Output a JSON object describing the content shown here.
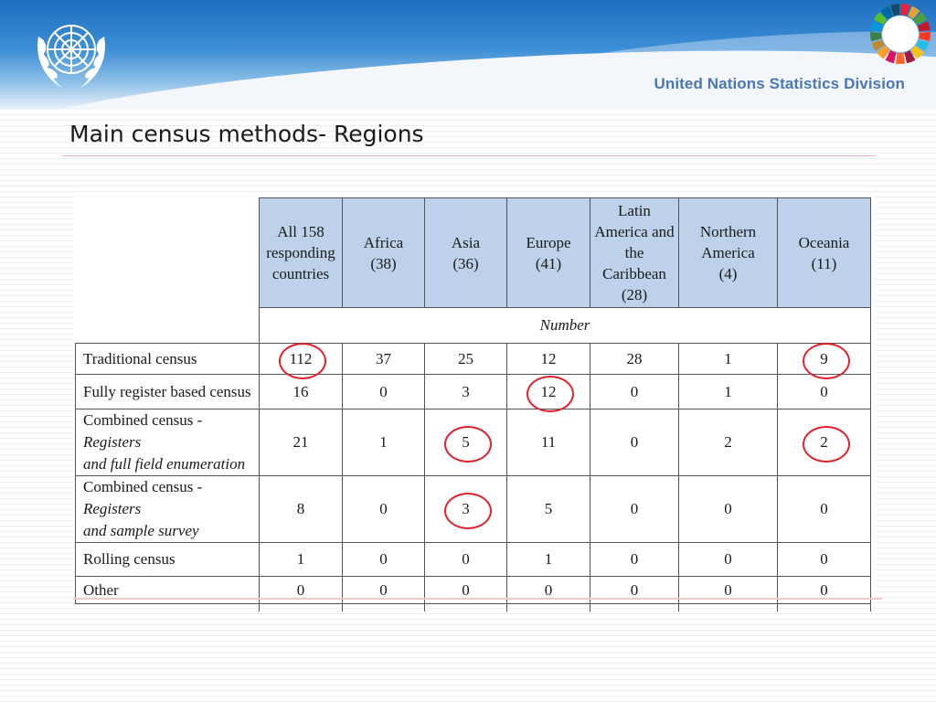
{
  "header": {
    "organization": "United Nations Statistics Division",
    "left_logo": "un-emblem",
    "right_logo": "sdg-color-wheel"
  },
  "title": "Main census methods- Regions",
  "table": {
    "columns": [
      {
        "lines": [
          "All 158",
          "responding",
          "countries"
        ]
      },
      {
        "lines": [
          "Africa",
          "(38)"
        ]
      },
      {
        "lines": [
          "Asia",
          "(36)"
        ]
      },
      {
        "lines": [
          "Europe",
          "(41)"
        ]
      },
      {
        "lines": [
          "Latin",
          "America and",
          "the",
          "Caribbean",
          "(28)"
        ]
      },
      {
        "lines": [
          "Northern",
          "America",
          "(4)"
        ]
      },
      {
        "lines": [
          "Oceania",
          "(11)"
        ]
      }
    ],
    "unit_label": "Number",
    "rows": [
      {
        "label": "Traditional census",
        "label_italic": "",
        "label2": "",
        "label2_italic": "",
        "values": [
          "112",
          "37",
          "25",
          "12",
          "28",
          "1",
          "9"
        ],
        "circled": [
          0,
          6
        ]
      },
      {
        "label": "Fully register based census",
        "label_italic": "",
        "label2": "",
        "label2_italic": "",
        "values": [
          "16",
          "0",
          "3",
          "12",
          "0",
          "1",
          "0"
        ],
        "circled": [
          3
        ]
      },
      {
        "label": "Combined census - ",
        "label_italic": "Registers",
        "label2": "",
        "label2_italic": "and full field enumeration",
        "values": [
          "21",
          "1",
          "5",
          "11",
          "0",
          "2",
          "2"
        ],
        "circled": [
          2,
          6
        ]
      },
      {
        "label": "Combined census - ",
        "label_italic": "Registers",
        "label2": "",
        "label2_italic": "and sample survey",
        "values": [
          "8",
          "0",
          "3",
          "5",
          "0",
          "0",
          "0"
        ],
        "circled": [
          2
        ]
      },
      {
        "label": "Rolling census",
        "label_italic": "",
        "label2": "",
        "label2_italic": "",
        "values": [
          "1",
          "0",
          "0",
          "1",
          "0",
          "0",
          "0"
        ],
        "circled": []
      },
      {
        "label": "Other",
        "label_italic": "",
        "label2": "",
        "label2_italic": "",
        "values": [
          "0",
          "0",
          "0",
          "0",
          "0",
          "0",
          "0"
        ],
        "circled": []
      }
    ]
  },
  "colors": {
    "header_fill": "#bdd2ea",
    "highlight_circle": "#e0202a",
    "banner_blue": "#1f6fc0",
    "division_text": "#4a78b5"
  }
}
